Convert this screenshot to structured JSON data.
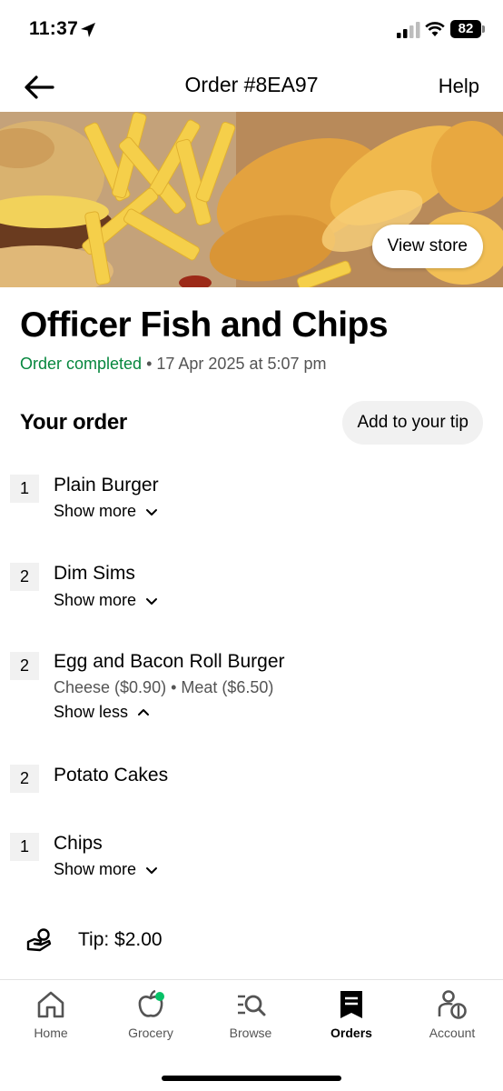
{
  "status_bar": {
    "time": "11:37",
    "battery": "82"
  },
  "header": {
    "title": "Order #8EA97",
    "help_label": "Help"
  },
  "hero": {
    "view_store_label": "View store"
  },
  "store": {
    "name": "Officer Fish and Chips",
    "status": "Order completed",
    "separator": " • ",
    "date": "17 Apr 2025 at 5:07 pm"
  },
  "order": {
    "heading": "Your order",
    "tip_button_label": "Add to your tip",
    "items": [
      {
        "qty": "1",
        "name": "Plain Burger",
        "toggle": "Show more"
      },
      {
        "qty": "2",
        "name": "Dim Sims",
        "toggle": "Show more"
      },
      {
        "qty": "2",
        "name": "Egg and Bacon Roll Burger",
        "options": "Cheese ($0.90) • Meat ($6.50)",
        "toggle": "Show less"
      },
      {
        "qty": "2",
        "name": "Potato Cakes"
      },
      {
        "qty": "1",
        "name": "Chips",
        "toggle": "Show more"
      }
    ],
    "tip_text": "Tip: $2.00"
  },
  "tabs": [
    {
      "label": "Home",
      "icon": "home-icon"
    },
    {
      "label": "Grocery",
      "icon": "grocery-icon"
    },
    {
      "label": "Browse",
      "icon": "browse-icon"
    },
    {
      "label": "Orders",
      "icon": "orders-icon",
      "active": true
    },
    {
      "label": "Account",
      "icon": "account-icon"
    }
  ],
  "colors": {
    "status_green": "#06873e",
    "grocery_dot": "#06c167"
  }
}
